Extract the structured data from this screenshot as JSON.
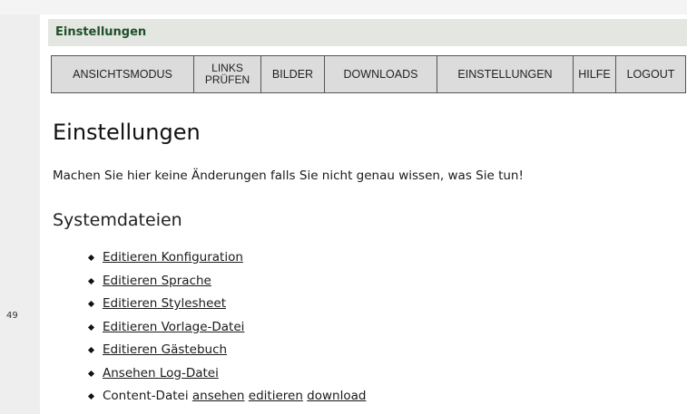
{
  "gutter": {
    "line_number": "49"
  },
  "title_bar": {
    "title": "Einstellungen"
  },
  "nav": {
    "items": [
      {
        "label": "ANSICHTSMODUS"
      },
      {
        "line1": "LINKS",
        "line2": "PRÜFEN"
      },
      {
        "label": "BILDER"
      },
      {
        "label": "DOWNLOADS"
      },
      {
        "label": "EINSTELLUNGEN"
      },
      {
        "label": "HILFE"
      },
      {
        "label": "LOGOUT"
      }
    ]
  },
  "main": {
    "heading": "Einstellungen",
    "warning": "Machen Sie hier keine Änderungen falls Sie nicht genau wissen, was Sie tun!",
    "section_heading": "Systemdateien",
    "links": [
      "Editieren Konfiguration",
      "Editieren Sprache",
      "Editieren Stylesheet",
      "Editieren Vorlage-Datei",
      "Editieren Gästebuch",
      "Ansehen Log-Datei"
    ],
    "content_file": {
      "prefix": "Content-Datei",
      "view": "ansehen",
      "edit": "editieren",
      "download": "download"
    }
  }
}
